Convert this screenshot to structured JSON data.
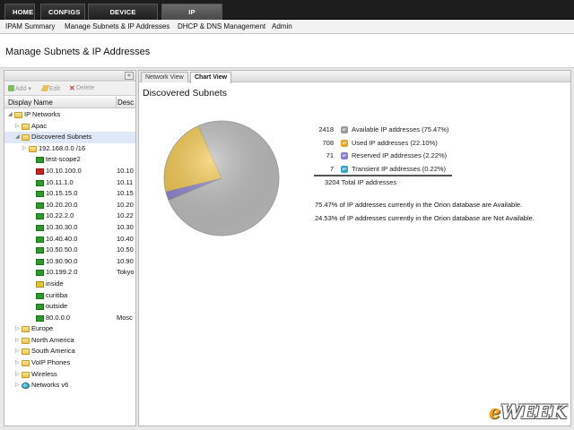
{
  "topnav": {
    "tabs": [
      {
        "label": "HOME"
      },
      {
        "label": "CONFIGS"
      },
      {
        "label": "DEVICE TRACKER"
      },
      {
        "label": "IP ADDRESSES",
        "active": true
      }
    ]
  },
  "subnav": {
    "items": [
      "IPAM Summary",
      "Manage Subnets & IP Addresses",
      "DHCP & DNS Management",
      "Admin"
    ]
  },
  "page": {
    "title": "Manage Subnets & IP Addresses"
  },
  "left_panel": {
    "collapse_label": "«",
    "toolbar": {
      "add": "Add",
      "edit": "Edit",
      "delete": "Delete"
    },
    "columns": {
      "name": "Display Name",
      "desc": "Desc"
    },
    "tree": [
      {
        "label": "IP Networks",
        "desc": "",
        "icon": "folder-icon",
        "expanded": true
      },
      {
        "label": "Apac",
        "desc": "",
        "icon": "folder-icon"
      },
      {
        "label": "Discovered Subnets",
        "desc": "",
        "icon": "folder-icon",
        "expanded": true,
        "selected": true
      },
      {
        "label": "192.168.0.0 /16",
        "desc": "",
        "icon": "folder-icon"
      },
      {
        "label": "test-scope2",
        "desc": "",
        "icon": "subnet-green-icon"
      },
      {
        "label": "10.10.100.0",
        "desc": "10.10",
        "icon": "subnet-red-icon"
      },
      {
        "label": "10.11.1.0",
        "desc": "10.11",
        "icon": "subnet-green-icon"
      },
      {
        "label": "10.15.15.0",
        "desc": "10.15",
        "icon": "subnet-green-icon"
      },
      {
        "label": "10.20.20.0",
        "desc": "10.20",
        "icon": "subnet-green-icon"
      },
      {
        "label": "10.22.2.0",
        "desc": "10.22",
        "icon": "subnet-green-icon"
      },
      {
        "label": "10.30.30.0",
        "desc": "10.30",
        "icon": "subnet-green-icon"
      },
      {
        "label": "10.40.40.0",
        "desc": "10.40",
        "icon": "subnet-green-icon"
      },
      {
        "label": "10.50.50.0",
        "desc": "10.50",
        "icon": "subnet-green-icon"
      },
      {
        "label": "10.90.90.0",
        "desc": "10.90",
        "icon": "subnet-green-icon"
      },
      {
        "label": "10.199.2.0",
        "desc": "Tokyo",
        "icon": "subnet-green-icon"
      },
      {
        "label": "inside",
        "desc": "",
        "icon": "subnet-yellow-icon"
      },
      {
        "label": "curitiba",
        "desc": "",
        "icon": "subnet-green-icon"
      },
      {
        "label": "outside",
        "desc": "",
        "icon": "subnet-green-icon"
      },
      {
        "label": "80.0.0.0",
        "desc": "Mosc",
        "icon": "subnet-green-icon"
      },
      {
        "label": "Europe",
        "desc": "",
        "icon": "folder-icon"
      },
      {
        "label": "North America",
        "desc": "",
        "icon": "folder-icon"
      },
      {
        "label": "South America",
        "desc": "",
        "icon": "folder-icon"
      },
      {
        "label": "VoIP Phones",
        "desc": "",
        "icon": "folder-icon"
      },
      {
        "label": "Wireless",
        "desc": "",
        "icon": "folder-icon"
      },
      {
        "label": "Networks v6",
        "desc": "",
        "icon": "globe-icon"
      }
    ]
  },
  "right_panel": {
    "tabs": [
      {
        "label": "Network View"
      },
      {
        "label": "Chart View",
        "active": true
      }
    ],
    "section_title": "Discovered Subnets",
    "notes": [
      "75.47% of IP addresses currently in the Orion database are Available.",
      "24.53% of IP addresses currently in the Orion database are Not Available."
    ]
  },
  "colors": {
    "available": "#bdbdbd",
    "used": "#f3c74a",
    "reserved": "#8c7fd0",
    "transient": "#3aa6c8"
  },
  "chart_data": {
    "type": "pie",
    "slices": [
      {
        "count": "2418",
        "label": "Available IP addresses (75.47%)",
        "value": 2418,
        "percent": 75.47,
        "color": "#bdbdbd"
      },
      {
        "count": "708",
        "label": "Used IP addresses (22.10%)",
        "value": 708,
        "percent": 22.1,
        "color": "#f3c74a"
      },
      {
        "count": "71",
        "label": "Reserved IP addresses (2.22%)",
        "value": 71,
        "percent": 2.22,
        "color": "#8c7fd0"
      },
      {
        "count": "7",
        "label": "Transient IP addresses (0.22%)",
        "value": 7,
        "percent": 0.22,
        "color": "#3aa6c8"
      }
    ],
    "total_text": "3204 Total IP addresses"
  },
  "watermark": {
    "prefix": "e",
    "rest": "WEEK"
  }
}
